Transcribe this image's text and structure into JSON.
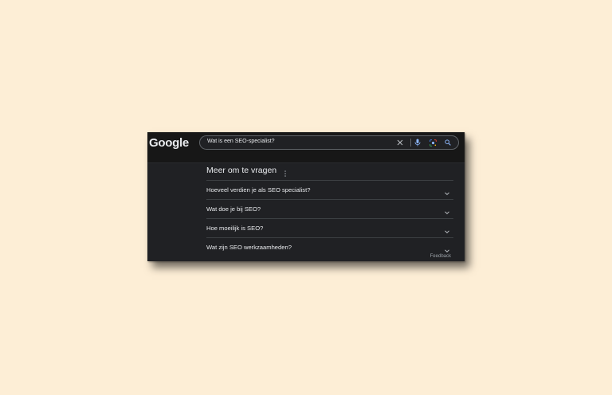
{
  "logo": "Google",
  "search": {
    "query": "Wat is een SEO-specialist?"
  },
  "icons": {
    "clear": "close-icon",
    "voice": "microphone-icon",
    "lens": "lens-icon",
    "search": "search-icon",
    "more": "more-vert-icon",
    "expand": "chevron-down-icon"
  },
  "colors": {
    "page_background": "#fdeed6",
    "results_background": "#202124",
    "header_background": "#171717",
    "text": "#e8eaed",
    "muted_text": "#9aa0a6",
    "accent_blue": "#8ab4f8"
  },
  "paa": {
    "heading": "Meer om te vragen",
    "questions": [
      {
        "text": "Hoeveel verdien je als SEO specialist?"
      },
      {
        "text": "Wat doe je bij SEO?"
      },
      {
        "text": "Hoe moeilijk is SEO?"
      },
      {
        "text": "Wat zijn SEO werkzaamheden?"
      }
    ],
    "feedback": "Feedback"
  }
}
